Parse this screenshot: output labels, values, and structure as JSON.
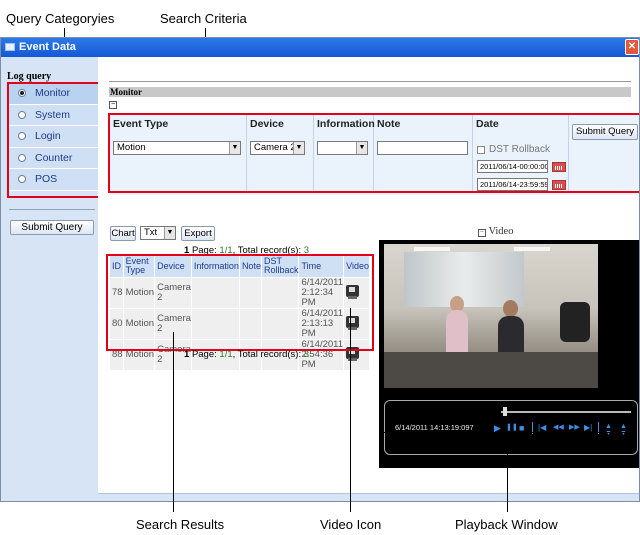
{
  "callouts": {
    "query_categories": "Query Categoryies",
    "search_criteria": "Search Criteria",
    "search_results": "Search Results",
    "video_icon": "Video Icon",
    "playback_window": "Playback Window"
  },
  "window": {
    "title": "Event Data",
    "close_glyph": "✕"
  },
  "sidebar": {
    "title": "Log query",
    "items": [
      {
        "label": "Monitor",
        "selected": true
      },
      {
        "label": "System",
        "selected": false
      },
      {
        "label": "Login",
        "selected": false
      },
      {
        "label": "Counter",
        "selected": false
      },
      {
        "label": "POS",
        "selected": false
      }
    ],
    "submit_label": "Submit Query"
  },
  "main": {
    "section_title": "Monitor",
    "collapse_glyph": "−",
    "criteria": {
      "event_type_label": "Event Type",
      "event_type_value": "Motion",
      "device_label": "Device",
      "device_value": "Camera 2",
      "information_label": "Information",
      "information_value": "",
      "note_label": "Note",
      "note_value": "",
      "date_label": "Date",
      "dst_label": "DST Rollback",
      "date_from": "2011/06/14-00:00:00",
      "date_to": "2011/06/14-23:59:59",
      "submit_label": "Submit Query"
    },
    "toolbar": {
      "chart_label": "Chart",
      "format_value": "Txt",
      "export_label": "Export"
    },
    "pager": {
      "page_number": "1",
      "page_label": "Page:",
      "page_fraction": "1/1",
      "total_label": ", Total record(s):",
      "total_count": "3"
    },
    "results": {
      "headers": [
        "ID",
        "Event Type",
        "Device",
        "Information",
        "Note",
        "DST Rollback",
        "Time",
        "Video"
      ],
      "rows": [
        {
          "id": "78",
          "event": "Motion",
          "device": "Camera 2",
          "information": "",
          "note": "",
          "dst": "",
          "time": "6/14/2011 2:12:34 PM"
        },
        {
          "id": "80",
          "event": "Motion",
          "device": "Camera 2",
          "information": "",
          "note": "",
          "dst": "",
          "time": "6/14/2011 2:13:13 PM"
        },
        {
          "id": "88",
          "event": "Motion",
          "device": "Camera 2",
          "information": "",
          "note": "",
          "dst": "",
          "time": "6/14/2011 2:54:36 PM"
        }
      ]
    },
    "video": {
      "title": "Video",
      "collapse_glyph": "−",
      "timestamp": "6/14/2011 14:13:19:097",
      "controls": {
        "play": "▶",
        "pause": "❚❚",
        "stop": "■",
        "prev": "|◀",
        "rewind": "◀◀",
        "forward": "▶▶",
        "next": "▶|"
      }
    }
  }
}
